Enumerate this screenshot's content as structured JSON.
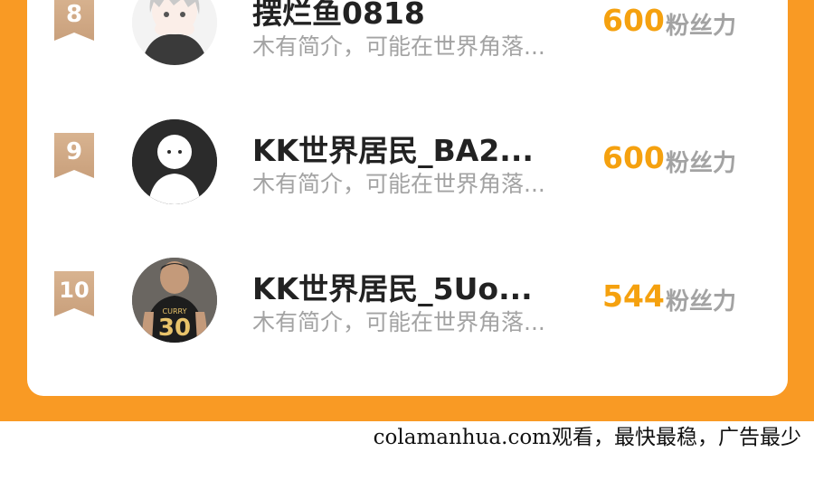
{
  "ranking": [
    {
      "rank": "8",
      "name": "摆烂鱼0818",
      "bio": "木有简介，可能在世界角落...",
      "fans": "600",
      "fans_label": "粉丝力",
      "avatar": "anime-girl-avatar"
    },
    {
      "rank": "9",
      "name": "KK世界居民_BA2...",
      "bio": "木有简介，可能在世界角落...",
      "fans": "600",
      "fans_label": "粉丝力",
      "avatar": "default-person-avatar"
    },
    {
      "rank": "10",
      "name": "KK世界居民_5Uo...",
      "bio": "木有简介，可能在世界角落...",
      "fans": "544",
      "fans_label": "粉丝力",
      "avatar": "basketball-jersey-avatar"
    }
  ],
  "jersey": {
    "number": "30",
    "name": "CURRY"
  },
  "footer": {
    "text": "colamanhua.com观看，最快最稳，广告最少"
  },
  "colors": {
    "frame": "#f99a24",
    "accent": "#f5a10f",
    "badge": "#d8b390"
  }
}
